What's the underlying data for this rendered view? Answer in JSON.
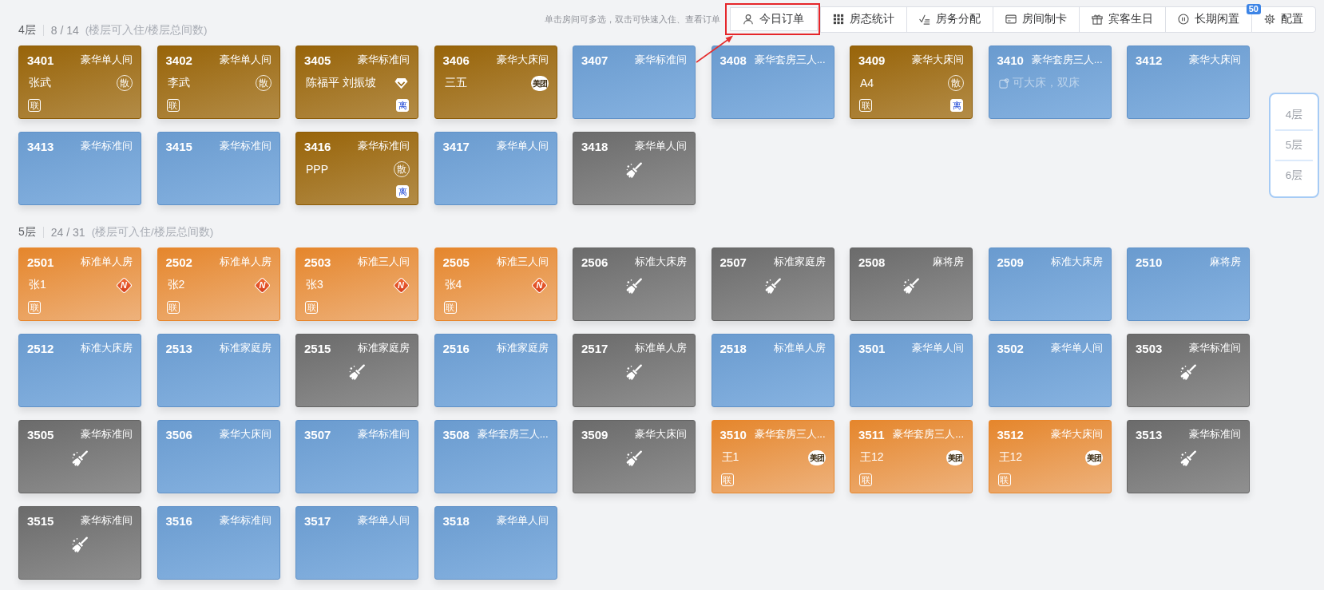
{
  "toolbar": {
    "hint": "单击房间可多选，双击可快速入住、查看订单",
    "buttons": [
      {
        "kind": "orders",
        "label": "今日订单",
        "highlighted": true
      },
      {
        "kind": "stats",
        "label": "房态统计",
        "highlighted": false
      },
      {
        "kind": "housekeeping",
        "label": "房务分配",
        "highlighted": false
      },
      {
        "kind": "card",
        "label": "房间制卡",
        "highlighted": false
      },
      {
        "kind": "birthday",
        "label": "宾客生日",
        "highlighted": false
      },
      {
        "kind": "idle",
        "label": "长期闲置",
        "highlighted": false,
        "badge": "50"
      },
      {
        "kind": "settings",
        "label": "配置",
        "highlighted": false
      }
    ]
  },
  "floors": [
    {
      "name": "4层",
      "count": "8 / 14",
      "count_note": "(楼层可入住/楼层总间数)",
      "rooms": [
        {
          "number": "3401",
          "type": "豪华单人间",
          "kind": "occupied",
          "guest": "张武",
          "source": {
            "kind": "walkin",
            "label": "散"
          },
          "tags": [
            {
              "kind": "linked",
              "label": "联"
            }
          ]
        },
        {
          "number": "3402",
          "type": "豪华单人间",
          "kind": "occupied",
          "guest": "李武",
          "source": {
            "kind": "walkin",
            "label": "散"
          },
          "tags": [
            {
              "kind": "linked",
              "label": "联"
            }
          ]
        },
        {
          "number": "3405",
          "type": "豪华标准间",
          "kind": "occupied",
          "guest": "陈福平 刘振坡",
          "source": {
            "kind": "vip"
          },
          "tags": [
            {
              "kind": "departing",
              "label": "离"
            }
          ]
        },
        {
          "number": "3406",
          "type": "豪华大床间",
          "kind": "occupied",
          "guest": "三五",
          "source": {
            "kind": "meituan",
            "label": "美团"
          }
        },
        {
          "number": "3407",
          "type": "豪华标准间",
          "kind": "vacant"
        },
        {
          "number": "3408",
          "type": "豪华套房三人...",
          "kind": "vacant"
        },
        {
          "number": "3409",
          "type": "豪华大床间",
          "kind": "occupied",
          "guest": "A4",
          "source": {
            "kind": "walkin",
            "label": "散"
          },
          "tags": [
            {
              "kind": "linked",
              "label": "联"
            },
            {
              "kind": "departing",
              "label": "离"
            }
          ]
        },
        {
          "number": "3410",
          "type": "豪华套房三人...",
          "kind": "vacant",
          "note": "可大床，双床"
        },
        {
          "number": "3412",
          "type": "豪华大床间",
          "kind": "vacant"
        },
        {
          "number": "3413",
          "type": "豪华标准间",
          "kind": "vacant"
        },
        {
          "number": "3415",
          "type": "豪华标准间",
          "kind": "vacant"
        },
        {
          "number": "3416",
          "type": "豪华标准间",
          "kind": "occupied",
          "guest": "PPP",
          "source": {
            "kind": "walkin",
            "label": "散"
          },
          "tags": [
            {
              "kind": "departing",
              "label": "离"
            }
          ]
        },
        {
          "number": "3417",
          "type": "豪华单人间",
          "kind": "vacant"
        },
        {
          "number": "3418",
          "type": "豪华单人间",
          "kind": "dirty"
        }
      ]
    },
    {
      "name": "5层",
      "count": "24 / 31",
      "count_note": "(楼层可入住/楼层总间数)",
      "rooms": [
        {
          "number": "2501",
          "type": "标准单人房",
          "kind": "arriving",
          "guest": "张1",
          "source": {
            "kind": "ota",
            "label": "N"
          },
          "tags": [
            {
              "kind": "linked",
              "label": "联"
            }
          ]
        },
        {
          "number": "2502",
          "type": "标准单人房",
          "kind": "arriving",
          "guest": "张2",
          "source": {
            "kind": "ota",
            "label": "N"
          },
          "tags": [
            {
              "kind": "linked",
              "label": "联"
            }
          ]
        },
        {
          "number": "2503",
          "type": "标准三人间",
          "kind": "arriving",
          "guest": "张3",
          "source": {
            "kind": "ota",
            "label": "N"
          },
          "tags": [
            {
              "kind": "linked",
              "label": "联"
            }
          ]
        },
        {
          "number": "2505",
          "type": "标准三人间",
          "kind": "arriving",
          "guest": "张4",
          "source": {
            "kind": "ota",
            "label": "N"
          },
          "tags": [
            {
              "kind": "linked",
              "label": "联"
            }
          ]
        },
        {
          "number": "2506",
          "type": "标准大床房",
          "kind": "dirty"
        },
        {
          "number": "2507",
          "type": "标准家庭房",
          "kind": "dirty"
        },
        {
          "number": "2508",
          "type": "麻将房",
          "kind": "dirty"
        },
        {
          "number": "2509",
          "type": "标准大床房",
          "kind": "vacant"
        },
        {
          "number": "2510",
          "type": "麻将房",
          "kind": "vacant"
        },
        {
          "number": "2512",
          "type": "标准大床房",
          "kind": "vacant"
        },
        {
          "number": "2513",
          "type": "标准家庭房",
          "kind": "vacant"
        },
        {
          "number": "2515",
          "type": "标准家庭房",
          "kind": "dirty"
        },
        {
          "number": "2516",
          "type": "标准家庭房",
          "kind": "vacant"
        },
        {
          "number": "2517",
          "type": "标准单人房",
          "kind": "dirty"
        },
        {
          "number": "2518",
          "type": "标准单人房",
          "kind": "vacant"
        },
        {
          "number": "3501",
          "type": "豪华单人间",
          "kind": "vacant"
        },
        {
          "number": "3502",
          "type": "豪华单人间",
          "kind": "vacant"
        },
        {
          "number": "3503",
          "type": "豪华标准间",
          "kind": "dirty"
        },
        {
          "number": "3505",
          "type": "豪华标准间",
          "kind": "dirty"
        },
        {
          "number": "3506",
          "type": "豪华大床间",
          "kind": "vacant"
        },
        {
          "number": "3507",
          "type": "豪华标准间",
          "kind": "vacant"
        },
        {
          "number": "3508",
          "type": "豪华套房三人...",
          "kind": "vacant"
        },
        {
          "number": "3509",
          "type": "豪华大床间",
          "kind": "dirty"
        },
        {
          "number": "3510",
          "type": "豪华套房三人...",
          "kind": "arriving",
          "guest": "王1",
          "source": {
            "kind": "meituan",
            "label": "美团"
          },
          "tags": [
            {
              "kind": "linked",
              "label": "联"
            }
          ]
        },
        {
          "number": "3511",
          "type": "豪华套房三人...",
          "kind": "arriving",
          "guest": "王12",
          "source": {
            "kind": "meituan",
            "label": "美团"
          },
          "tags": [
            {
              "kind": "linked",
              "label": "联"
            }
          ]
        },
        {
          "number": "3512",
          "type": "豪华大床间",
          "kind": "arriving",
          "guest": "王12",
          "source": {
            "kind": "meituan",
            "label": "美团"
          },
          "tags": [
            {
              "kind": "linked",
              "label": "联"
            }
          ]
        },
        {
          "number": "3513",
          "type": "豪华标准间",
          "kind": "dirty"
        },
        {
          "number": "3515",
          "type": "豪华标准间",
          "kind": "dirty"
        },
        {
          "number": "3516",
          "type": "豪华标准间",
          "kind": "vacant"
        },
        {
          "number": "3517",
          "type": "豪华单人间",
          "kind": "vacant"
        },
        {
          "number": "3518",
          "type": "豪华单人间",
          "kind": "vacant"
        }
      ]
    }
  ],
  "floor_nav": [
    {
      "label": "4层"
    },
    {
      "label": "5层"
    },
    {
      "label": "6层"
    }
  ]
}
